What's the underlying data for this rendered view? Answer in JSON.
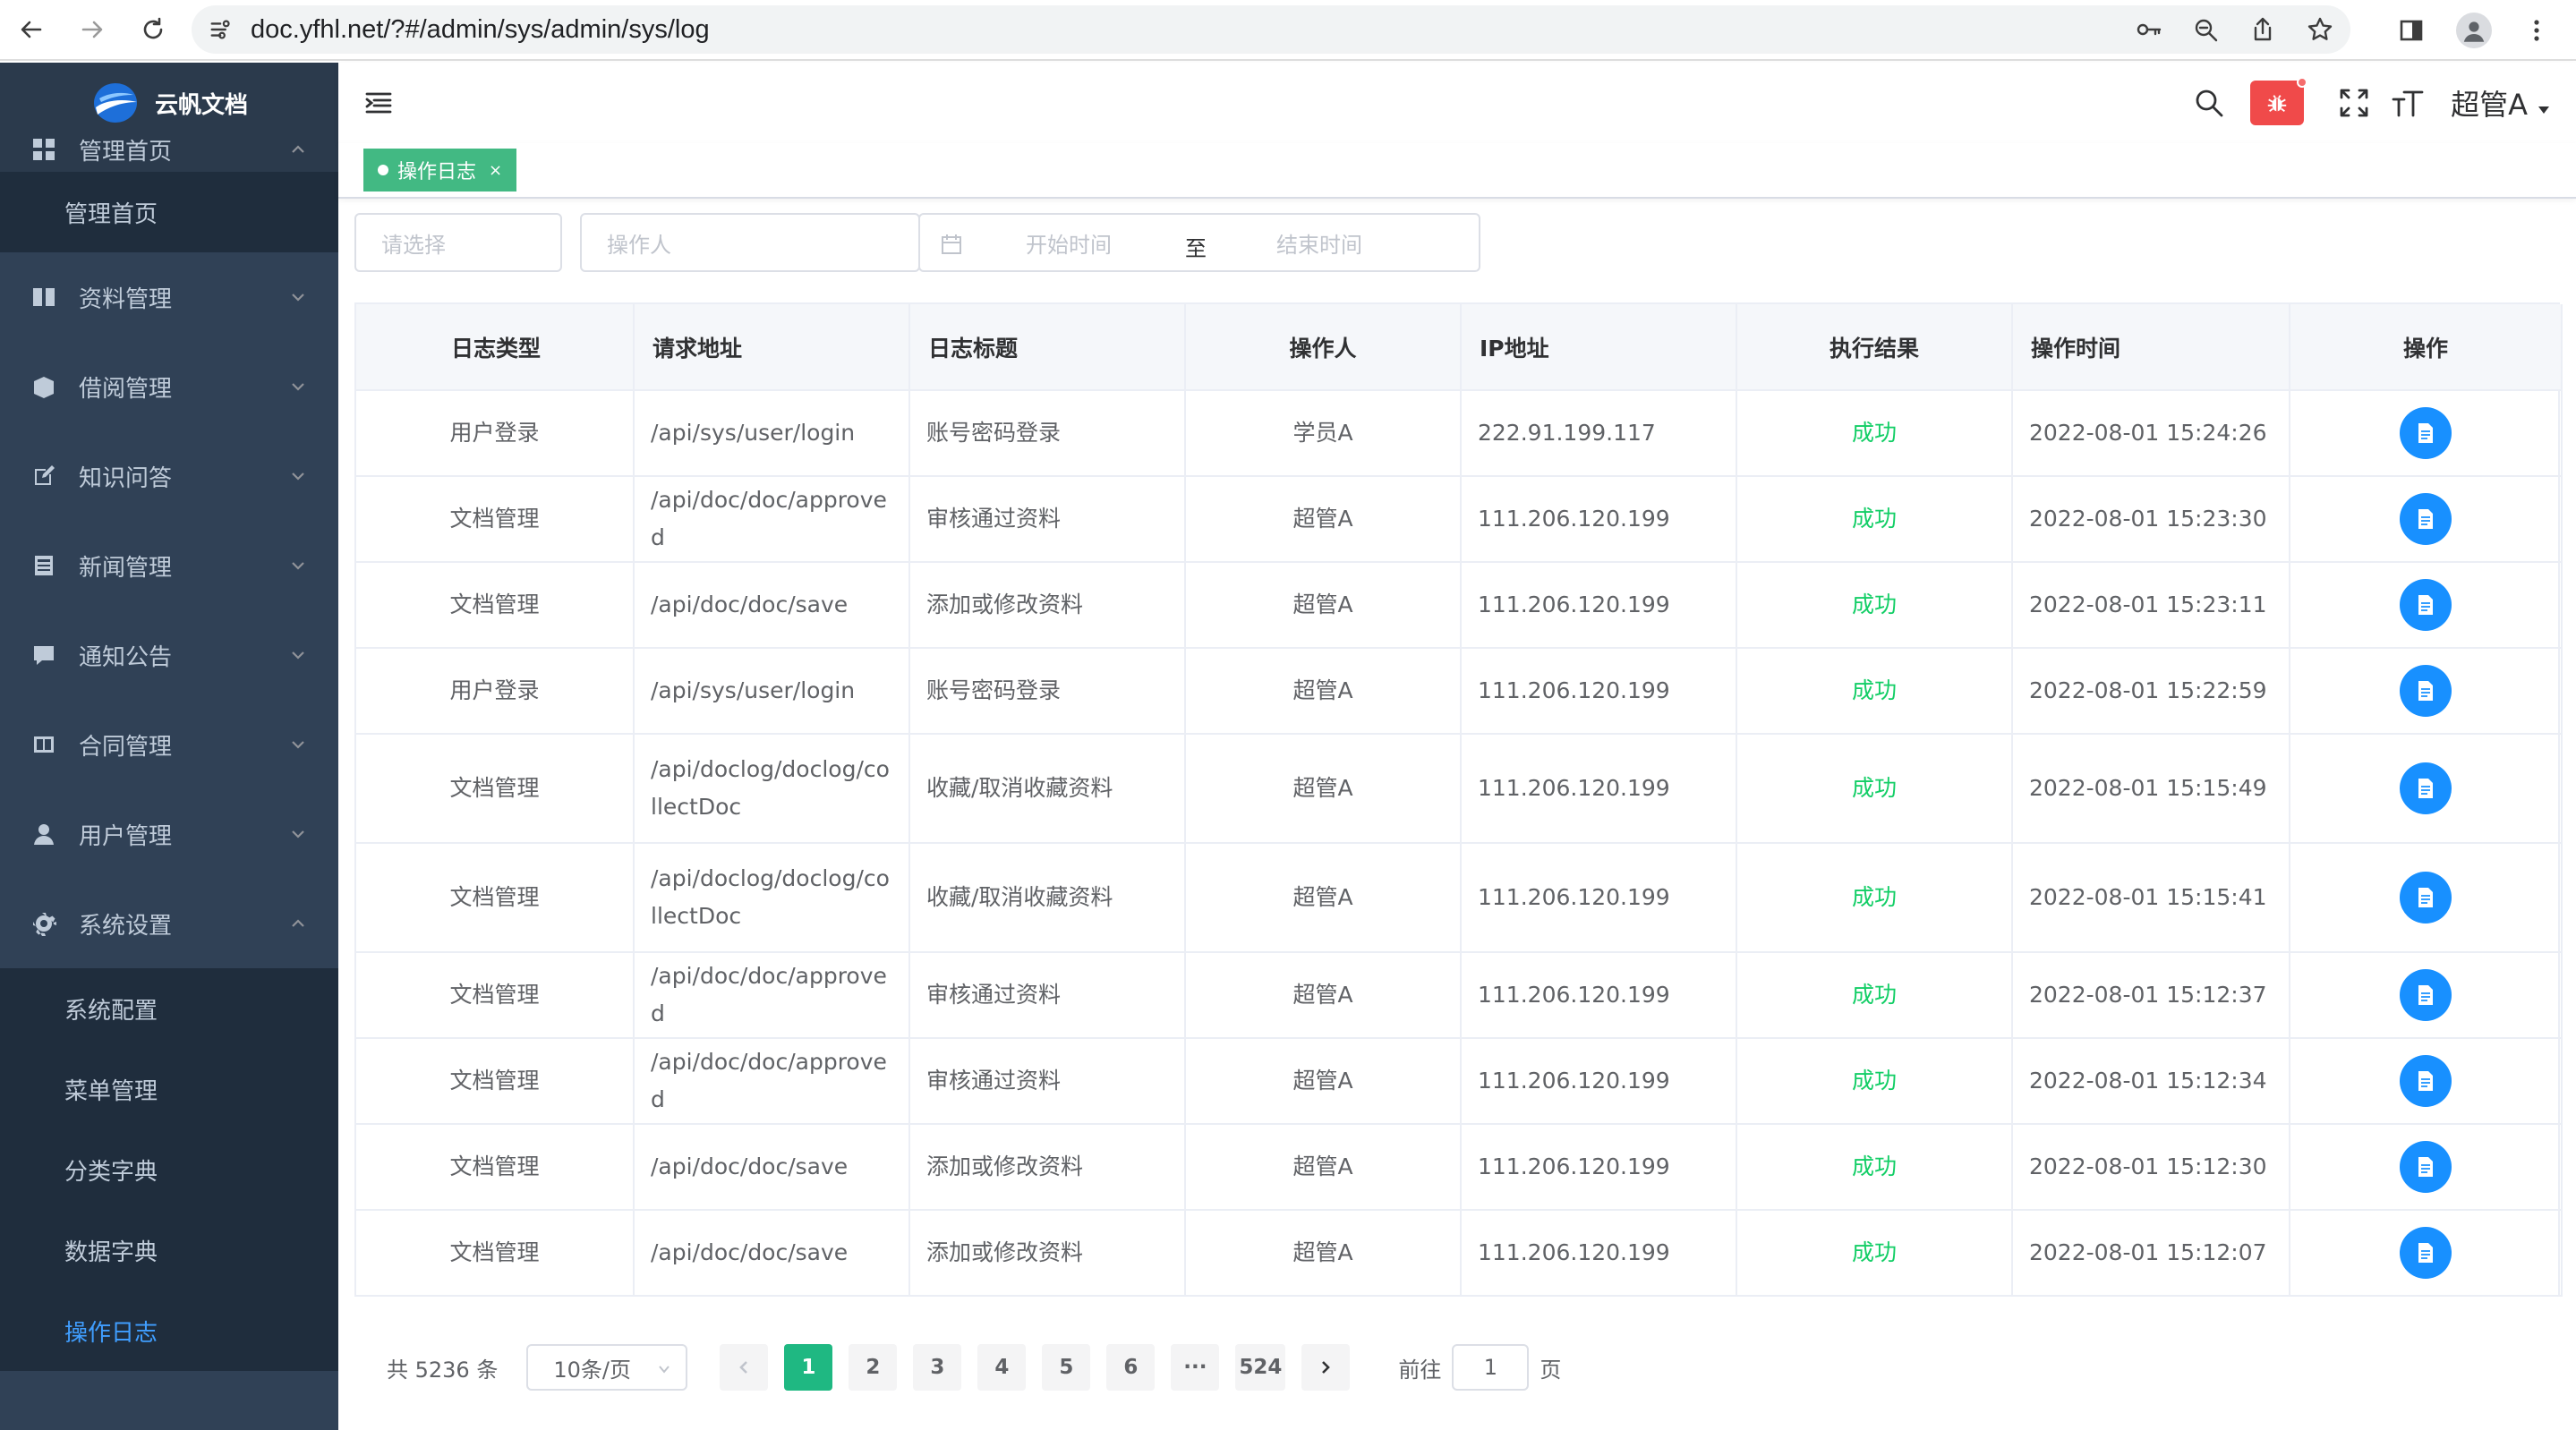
{
  "browser": {
    "url": "doc.yfhl.net/?#/admin/sys/admin/sys/log"
  },
  "app": {
    "name": "云帆文档",
    "user": "超管A"
  },
  "sidebar": {
    "groups": [
      {
        "label": "管理首页",
        "icon": "dashboard-icon",
        "expanded": true,
        "children": [
          "管理首页"
        ]
      },
      {
        "label": "资料管理",
        "icon": "book-icon"
      },
      {
        "label": "借阅管理",
        "icon": "box-icon"
      },
      {
        "label": "知识问答",
        "icon": "edit-icon"
      },
      {
        "label": "新闻管理",
        "icon": "news-icon"
      },
      {
        "label": "通知公告",
        "icon": "message-icon"
      },
      {
        "label": "合同管理",
        "icon": "contract-icon"
      },
      {
        "label": "用户管理",
        "icon": "user-icon"
      },
      {
        "label": "系统设置",
        "icon": "gear-icon",
        "expanded": true,
        "children": [
          "系统配置",
          "菜单管理",
          "分类字典",
          "数据字典",
          "操作日志"
        ]
      }
    ],
    "active": "操作日志"
  },
  "tags": [
    {
      "label": "操作日志",
      "close": "×"
    }
  ],
  "filters": {
    "type_placeholder": "请选择",
    "user_placeholder": "操作人",
    "start_placeholder": "开始时间",
    "range_sep": "至",
    "end_placeholder": "结束时间"
  },
  "table": {
    "columns": [
      "日志类型",
      "请求地址",
      "日志标题",
      "操作人",
      "IP地址",
      "执行结果",
      "操作时间",
      "操作"
    ],
    "rows": [
      {
        "type": "用户登录",
        "path": "/api/sys/user/login",
        "title": "账号密码登录",
        "user": "学员A",
        "ip": "222.91.199.117",
        "result": "成功",
        "time": "2022-08-01 15:24:26"
      },
      {
        "type": "文档管理",
        "path": "/api/doc/doc/approved",
        "title": "审核通过资料",
        "user": "超管A",
        "ip": "111.206.120.199",
        "result": "成功",
        "time": "2022-08-01 15:23:30"
      },
      {
        "type": "文档管理",
        "path": "/api/doc/doc/save",
        "title": "添加或修改资料",
        "user": "超管A",
        "ip": "111.206.120.199",
        "result": "成功",
        "time": "2022-08-01 15:23:11"
      },
      {
        "type": "用户登录",
        "path": "/api/sys/user/login",
        "title": "账号密码登录",
        "user": "超管A",
        "ip": "111.206.120.199",
        "result": "成功",
        "time": "2022-08-01 15:22:59"
      },
      {
        "type": "文档管理",
        "path": "/api/doclog/doclog/collectDoc",
        "title": "收藏/取消收藏资料",
        "user": "超管A",
        "ip": "111.206.120.199",
        "result": "成功",
        "time": "2022-08-01 15:15:49"
      },
      {
        "type": "文档管理",
        "path": "/api/doclog/doclog/collectDoc",
        "title": "收藏/取消收藏资料",
        "user": "超管A",
        "ip": "111.206.120.199",
        "result": "成功",
        "time": "2022-08-01 15:15:41"
      },
      {
        "type": "文档管理",
        "path": "/api/doc/doc/approved",
        "title": "审核通过资料",
        "user": "超管A",
        "ip": "111.206.120.199",
        "result": "成功",
        "time": "2022-08-01 15:12:37"
      },
      {
        "type": "文档管理",
        "path": "/api/doc/doc/approved",
        "title": "审核通过资料",
        "user": "超管A",
        "ip": "111.206.120.199",
        "result": "成功",
        "time": "2022-08-01 15:12:34"
      },
      {
        "type": "文档管理",
        "path": "/api/doc/doc/save",
        "title": "添加或修改资料",
        "user": "超管A",
        "ip": "111.206.120.199",
        "result": "成功",
        "time": "2022-08-01 15:12:30"
      },
      {
        "type": "文档管理",
        "path": "/api/doc/doc/save",
        "title": "添加或修改资料",
        "user": "超管A",
        "ip": "111.206.120.199",
        "result": "成功",
        "time": "2022-08-01 15:12:07"
      }
    ]
  },
  "pagination": {
    "total": "共 5236 条",
    "page_size": "10条/页",
    "pages": [
      "1",
      "2",
      "3",
      "4",
      "5",
      "6",
      "···",
      "524"
    ],
    "current": "1",
    "goto_prefix": "前往",
    "goto_value": "1",
    "goto_suffix": "页"
  },
  "colors": {
    "sidebar_bg": "#304156",
    "sidebar_active": "#409eff",
    "tag_bg": "#42b983",
    "success": "#13ce66",
    "action_btn": "#1890ff",
    "pager_active": "#1fb882",
    "bug_btn": "#f04a4a"
  }
}
